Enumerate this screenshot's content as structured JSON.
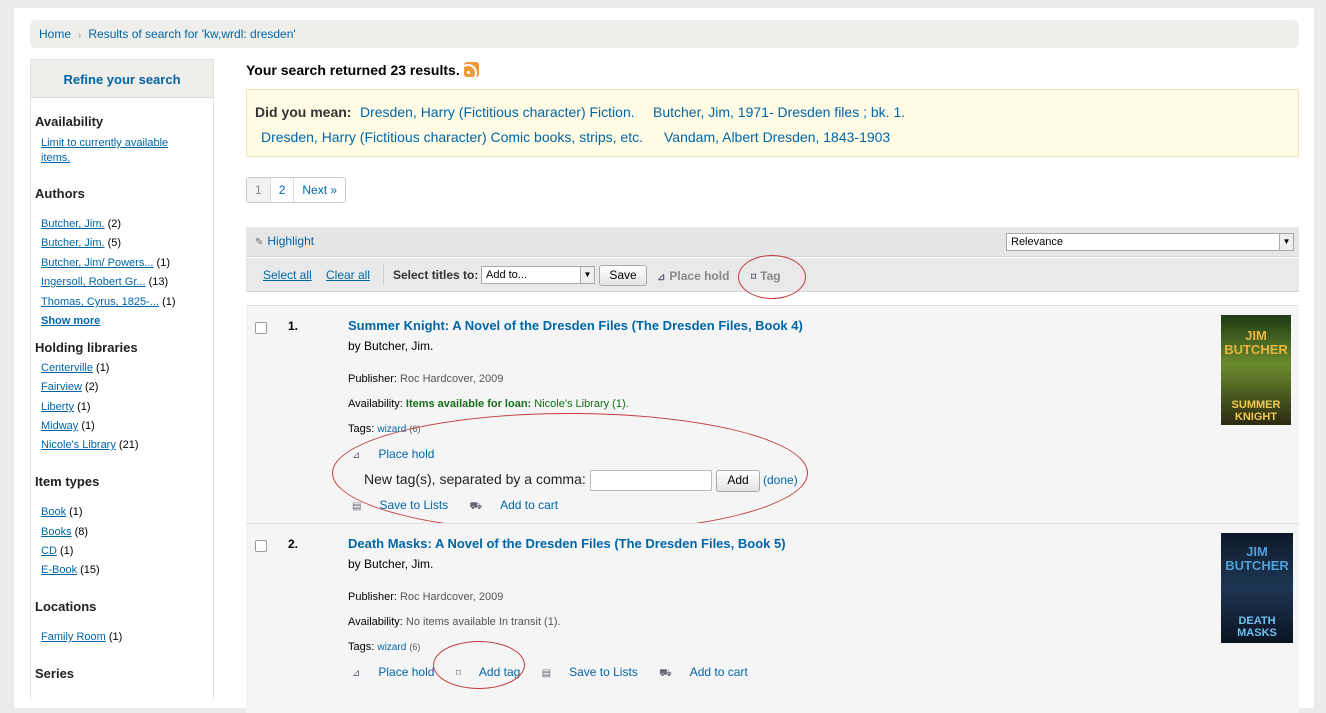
{
  "breadcrumb": {
    "home": "Home",
    "current": "Results of search for 'kw,wrdl: dresden'"
  },
  "sidebar": {
    "title": "Refine your search",
    "availability": {
      "heading": "Availability",
      "link_line1": "Limit to currently available",
      "link_line2": "items."
    },
    "authors": {
      "heading": "Authors",
      "items": [
        {
          "label": "Butcher, Jim.",
          "count": "(2)"
        },
        {
          "label": "Butcher, Jim.",
          "count": "(5)"
        },
        {
          "label": "Butcher, Jim/ Powers...",
          "count": "(1)"
        },
        {
          "label": "Ingersoll, Robert Gr...",
          "count": "(13)"
        },
        {
          "label": "Thomas, Cyrus, 1825-...",
          "count": "(1)"
        }
      ],
      "show_more": "Show more"
    },
    "libraries": {
      "heading": "Holding libraries",
      "items": [
        {
          "label": "Centerville",
          "count": "(1)"
        },
        {
          "label": "Fairview",
          "count": "(2)"
        },
        {
          "label": "Liberty",
          "count": "(1)"
        },
        {
          "label": "Midway",
          "count": "(1)"
        },
        {
          "label": "Nicole's Library",
          "count": "(21)"
        }
      ]
    },
    "itemtypes": {
      "heading": "Item types",
      "items": [
        {
          "label": "Book",
          "count": "(1)"
        },
        {
          "label": "Books",
          "count": "(8)"
        },
        {
          "label": "CD",
          "count": "(1)"
        },
        {
          "label": "E-Book",
          "count": "(15)"
        }
      ]
    },
    "locations": {
      "heading": "Locations",
      "items": [
        {
          "label": "Family Room",
          "count": "(1)"
        }
      ]
    },
    "series": {
      "heading": "Series"
    }
  },
  "main": {
    "result_count": "Your search returned 23 results.",
    "didyoumean": {
      "label": "Did you mean:",
      "suggestions": [
        "Dresden, Harry (Fictitious character) Fiction.",
        "Butcher, Jim, 1971- Dresden files ; bk. 1.",
        "Dresden, Harry (Fictitious character) Comic books, strips, etc.",
        "Vandam, Albert Dresden, 1843-1903"
      ]
    },
    "pagination": {
      "p1": "1",
      "p2": "2",
      "next": "Next »"
    },
    "toolbar": {
      "highlight": "Highlight",
      "sort": "Relevance",
      "select_all": "Select all",
      "clear_all": "Clear all",
      "select_titles": "Select titles to:",
      "add_to": "Add to...",
      "save": "Save",
      "place_hold": "Place hold",
      "tag": "Tag"
    },
    "results": [
      {
        "number": "1.",
        "title": "Summer Knight: A Novel of the Dresden Files (The Dresden Files, Book 4)",
        "by": "by Butcher, Jim.",
        "publisher_label": "Publisher:",
        "publisher": "Roc Hardcover, 2009",
        "availability_label": "Availability:",
        "availability_status": "Items available for loan:",
        "availability_detail": "Nicole's Library (1).",
        "tags_label": "Tags:",
        "tag": "wizard",
        "tag_count": "(6)",
        "place_hold": "Place hold",
        "new_tag_label": "New tag(s), separated by a comma:",
        "new_tag_value": "",
        "add_button": "Add",
        "done": "(done)",
        "save_to_lists": "Save to Lists",
        "add_to_cart": "Add to cart",
        "cover_author": "JIM BUTCHER",
        "cover_title": "SUMMER KNIGHT"
      },
      {
        "number": "2.",
        "title": "Death Masks: A Novel of the Dresden Files (The Dresden Files, Book 5)",
        "by": "by Butcher, Jim.",
        "publisher_label": "Publisher:",
        "publisher": "Roc Hardcover, 2009",
        "availability_label": "Availability:",
        "availability_detail": "No items available In transit (1).",
        "tags_label": "Tags:",
        "tag": "wizard",
        "tag_count": "(6)",
        "place_hold": "Place hold",
        "add_tag": "Add tag",
        "save_to_lists": "Save to Lists",
        "add_to_cart": "Add to cart",
        "cover_author": "JIM BUTCHER",
        "cover_title": "DEATH MASKS"
      }
    ]
  },
  "colors": {
    "link": "#0066a8",
    "available": "#137018",
    "annotation": "#c23b3b",
    "didyoumean_bg": "#fffbe5"
  }
}
